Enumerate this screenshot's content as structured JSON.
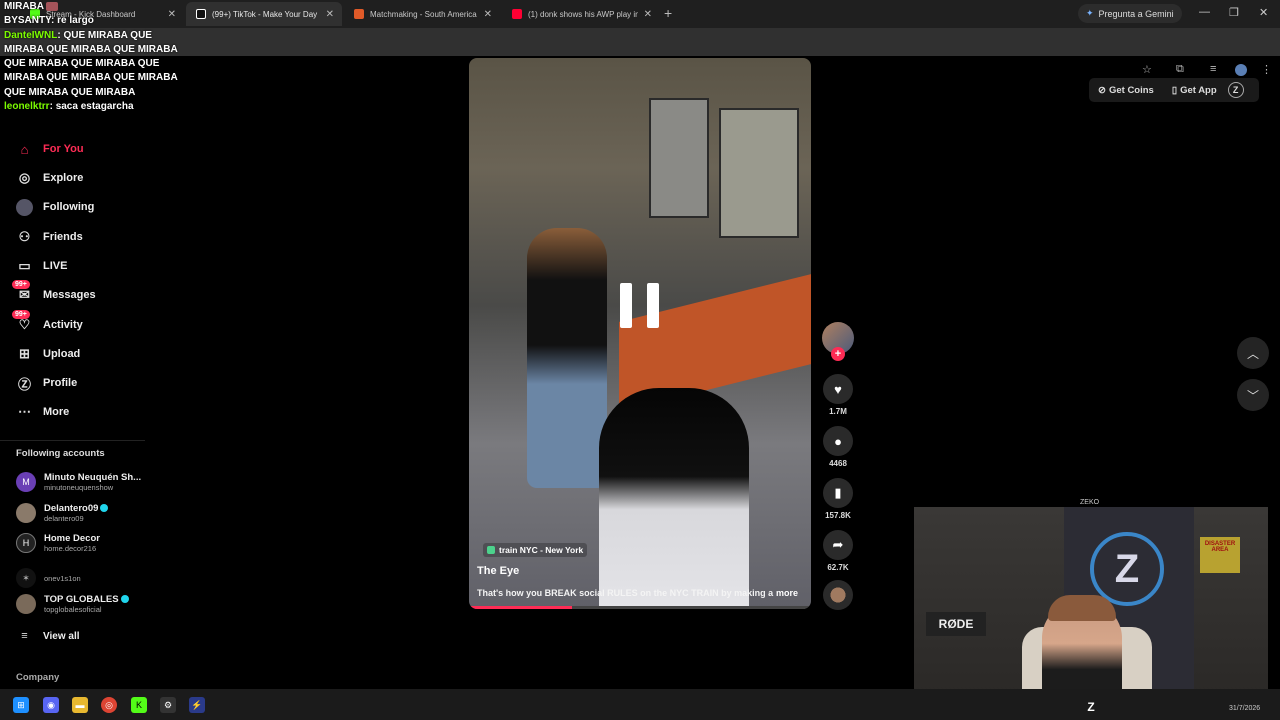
{
  "browser": {
    "tabs": [
      {
        "title": "Stream - Kick Dashboard",
        "color": "#53fc18"
      },
      {
        "title": "(99+) TikTok - Make Your Day",
        "color": "#ffffff",
        "active": true
      },
      {
        "title": "Matchmaking - South America",
        "color": "#e05a28"
      },
      {
        "title": "(1) donk shows his AWP play in",
        "color": "#ff0033"
      }
    ],
    "gemini_label": "Pregunta a Gemini"
  },
  "chat": [
    {
      "user": "",
      "text": "MIRABA"
    },
    {
      "user": "BYSANTY",
      "text": "re largo"
    },
    {
      "user": "DanteIWNL",
      "text": "QUE MIRABA QUE MIRABA QUE MIRABA QUE MIRABA QUE MIRABA QUE MIRABA QUE MIRABA QUE MIRABA QUE MIRABA QUE MIRABA QUE MIRABA"
    },
    {
      "user": "leonelktrr",
      "text": "saca estagarcha"
    }
  ],
  "sidebar": {
    "nav": [
      {
        "label": "For You",
        "icon": "home-icon"
      },
      {
        "label": "Explore",
        "icon": "compass-icon"
      },
      {
        "label": "Following",
        "icon": "following-icon"
      },
      {
        "label": "Friends",
        "icon": "friends-icon"
      },
      {
        "label": "LIVE",
        "icon": "live-icon"
      },
      {
        "label": "Messages",
        "icon": "messages-icon",
        "badge": "99+"
      },
      {
        "label": "Activity",
        "icon": "activity-icon",
        "badge": "99+"
      },
      {
        "label": "Upload",
        "icon": "upload-icon"
      },
      {
        "label": "Profile",
        "icon": "profile-icon"
      },
      {
        "label": "More",
        "icon": "more-icon"
      }
    ],
    "following_title": "Following accounts",
    "accounts": [
      {
        "name": "Minuto Neuquén Sh...",
        "handle": "minutoneuquenshow",
        "initial": "M"
      },
      {
        "name": "Delantero09",
        "handle": "delantero09",
        "verified": true
      },
      {
        "name": "Home Decor",
        "handle": "home.decor216",
        "initial": "H"
      },
      {
        "name": "",
        "handle": "onev1s1on"
      },
      {
        "name": "TOP GLOBALES",
        "handle": "topglobalesoficial",
        "verified": true
      }
    ],
    "view_all": "View all",
    "company": "Company"
  },
  "video": {
    "location": "train NYC - New York",
    "title": "The Eye",
    "description": "That's how you BREAK social RULES on the NYC TRAIN by making a",
    "more": "more",
    "progress": 0.3
  },
  "actions": {
    "likes": "1.7M",
    "comments": "4468",
    "saves": "157.8K",
    "shares": "62.7K"
  },
  "header": {
    "get_coins": "Get Coins",
    "get_app": "Get App"
  },
  "webcam": {
    "label": "ZEKO",
    "mic_brand": "RØDE",
    "poster": "DISASTER AREA"
  },
  "clock": "31/7/2026"
}
